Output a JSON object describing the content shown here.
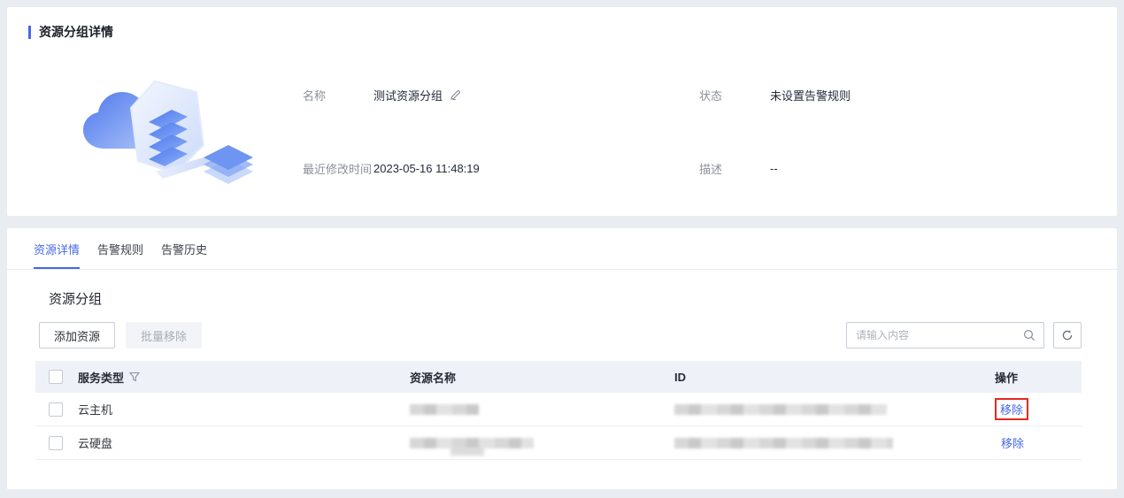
{
  "page": {
    "title": "资源分组详情"
  },
  "details": {
    "fields": [
      {
        "label": "名称",
        "value": "测试资源分组",
        "editable": true
      },
      {
        "label": "状态",
        "value": "未设置告警规则"
      },
      {
        "label": "最近修改时间",
        "value": "2023-05-16 11:48:19"
      },
      {
        "label": "描述",
        "value": "--"
      }
    ]
  },
  "tabs": [
    {
      "label": "资源详情",
      "active": true
    },
    {
      "label": "告警规则",
      "active": false
    },
    {
      "label": "告警历史",
      "active": false
    }
  ],
  "section": {
    "title": "资源分组"
  },
  "toolbar": {
    "add_button": "添加资源",
    "batch_remove_button": "批量移除",
    "search_placeholder": "请输入内容"
  },
  "table": {
    "headers": {
      "service_type": "服务类型",
      "resource_name": "资源名称",
      "id": "ID",
      "action": "操作"
    },
    "rows": [
      {
        "service_type": "云主机",
        "name_redacted": true,
        "id_redacted": true,
        "action": "移除",
        "action_highlighted": true
      },
      {
        "service_type": "云硬盘",
        "name_redacted": true,
        "id_redacted": true,
        "action": "移除",
        "action_highlighted": false
      }
    ]
  },
  "colors": {
    "accent": "#4668e5",
    "highlight_red": "#e22a1f",
    "table_header_bg": "#eef1f8",
    "page_bg": "#e9ecf1"
  }
}
